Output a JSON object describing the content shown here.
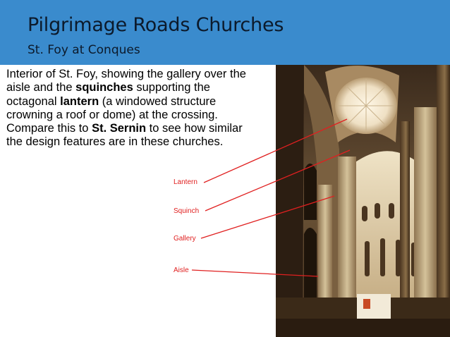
{
  "slide": {
    "title": "Pilgrimage Roads Churches",
    "subtitle": "St. Foy at Conques"
  },
  "body": {
    "seg1": "Interior of St. Foy, showing the gallery over the aisle and the ",
    "squinches": "squinches",
    "seg2": " supporting the octagonal ",
    "lantern": "lantern",
    "seg3": " (a windowed structure crowning a roof or dome) at the crossing. Compare this to ",
    "sernin": "St. Sernin",
    "seg4": " to see how similar the design features are in these churches."
  },
  "labels": {
    "lantern": "Lantern",
    "squinch": "Squinch",
    "gallery": "Gallery",
    "aisle": "Aisle"
  },
  "colors": {
    "header_bg": "#3a8bcd",
    "title_text": "#0c1a2b",
    "label_red": "#e02020"
  },
  "image": {
    "subject": "interior-photo-st-foy-conques"
  }
}
